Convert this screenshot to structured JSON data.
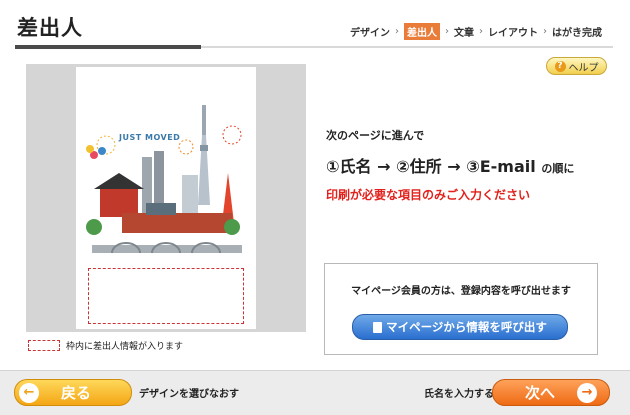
{
  "header": {
    "title": "差出人",
    "steps": [
      "デザイン",
      "差出人",
      "文章",
      "レイアウト",
      "はがき完成"
    ],
    "separator": "›"
  },
  "help": {
    "label": "ヘルプ",
    "icon": "question-icon"
  },
  "preview": {
    "illustration_text": "JUST MOVED",
    "legend": "枠内に差出人情報が入ります"
  },
  "instructions": {
    "line1": "次のページに進んで",
    "line2_main": "①氏名 → ②住所 → ③E-mail",
    "line2_suffix": "の順に",
    "line3": "印刷が必要な項目のみご入力ください"
  },
  "mypage": {
    "text": "マイページ会員の方は、登録内容を呼び出せます",
    "button": "マイページから情報を呼び出す"
  },
  "footer": {
    "back_button": "戻る",
    "back_note": "デザインを選びなおす",
    "next_note": "氏名を入力する",
    "next_button": "次へ"
  },
  "colors": {
    "accent_orange": "#ea7c3a",
    "warning_red": "#e2211c",
    "button_blue": "#2a6fcf"
  }
}
